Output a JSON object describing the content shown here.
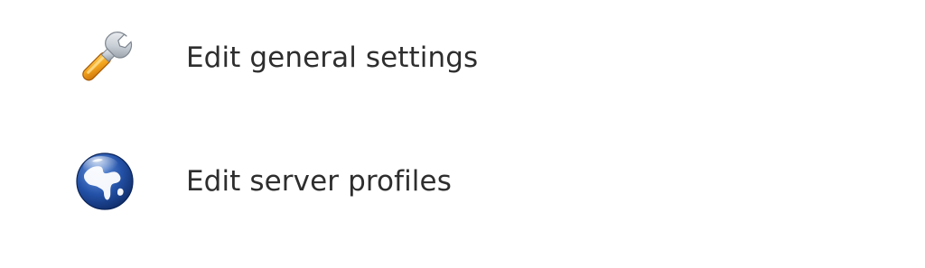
{
  "menu": {
    "items": [
      {
        "label": "Edit general settings",
        "icon": "wrench-icon"
      },
      {
        "label": "Edit server profiles",
        "icon": "globe-icon"
      }
    ]
  },
  "colors": {
    "text": "#2e2e2e",
    "wrench_handle": "#f0a21c",
    "wrench_metal": "#d8dde3",
    "globe_ocean": "#1e4fa6",
    "globe_land": "#ffffff"
  }
}
